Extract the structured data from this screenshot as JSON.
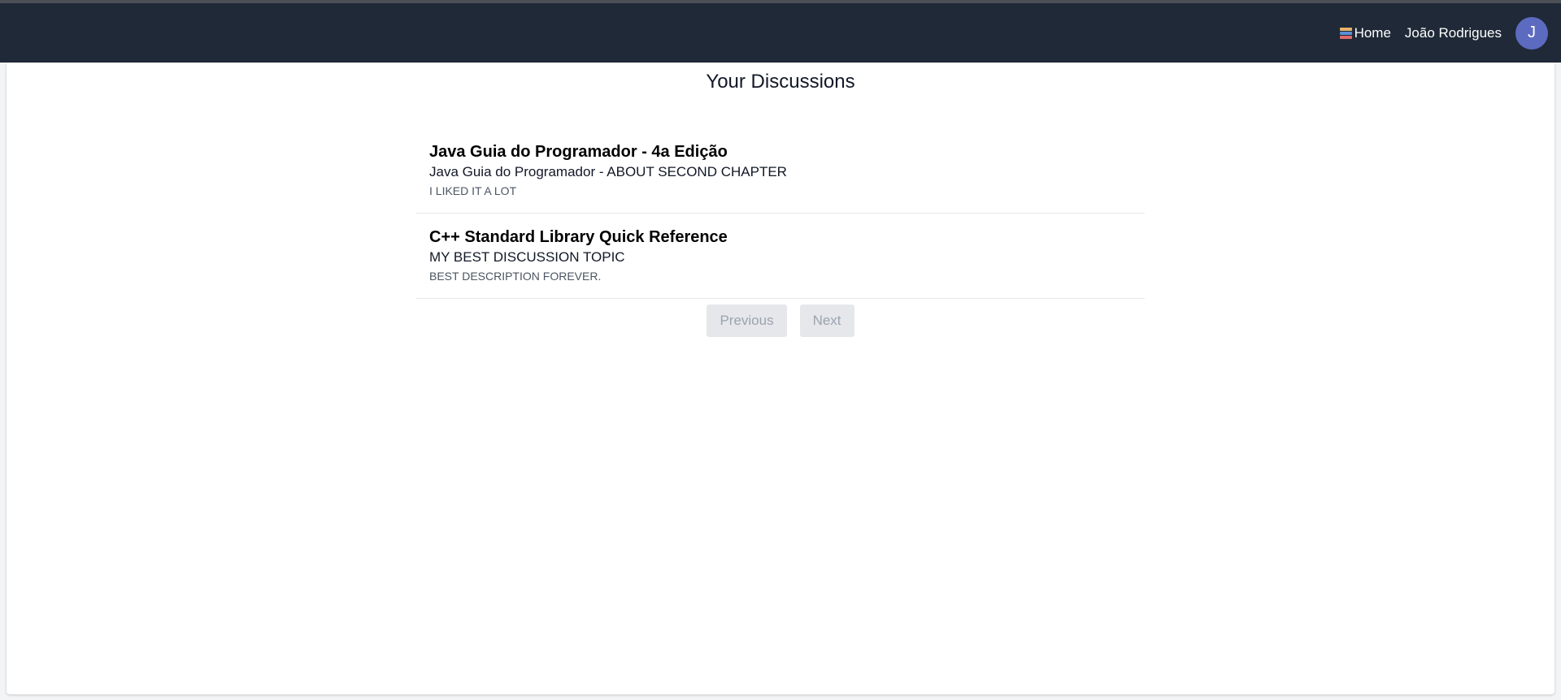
{
  "header": {
    "home_label": "Home",
    "user_name": "João Rodrigues",
    "avatar_initial": "J"
  },
  "page": {
    "title": "Your Discussions"
  },
  "discussions": [
    {
      "book": "Java Guia do Programador - 4a Edição",
      "title": "Java Guia do Programador - ABOUT SECOND CHAPTER",
      "description": "I LIKED IT A LOT"
    },
    {
      "book": "C++ Standard Library Quick Reference",
      "title": "MY BEST DISCUSSION TOPIC",
      "description": "BEST DESCRIPTION FOREVER."
    }
  ],
  "pagination": {
    "previous_label": "Previous",
    "next_label": "Next"
  },
  "colors": {
    "navbar": "#1f2937",
    "avatar": "#5c6bc0",
    "button_bg": "#e5e7eb",
    "button_text": "#9ca3af"
  }
}
